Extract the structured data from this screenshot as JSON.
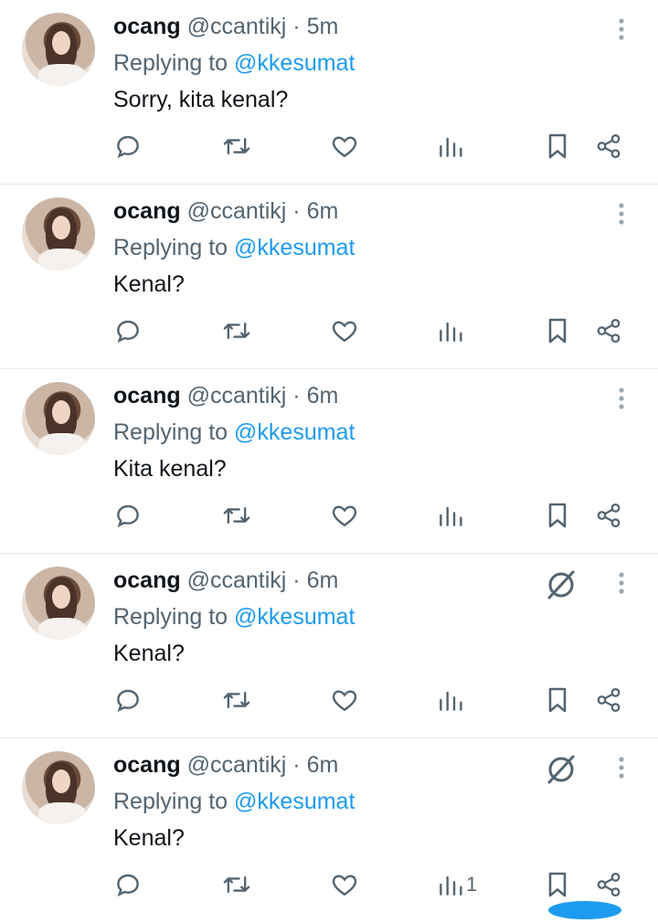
{
  "colors": {
    "text": "#0f1419",
    "secondary": "#536471",
    "accent": "#1d9bf0",
    "divider": "#e7e9ea"
  },
  "tweets": [
    {
      "name": "ocang",
      "handle": "@ccantikj",
      "separator": "·",
      "time": "5m",
      "replying_label": "Replying to",
      "mention": "@kkesumat",
      "text": "Sorry, kita kenal?",
      "views_count": "",
      "grok": false
    },
    {
      "name": "ocang",
      "handle": "@ccantikj",
      "separator": "·",
      "time": "6m",
      "replying_label": "Replying to",
      "mention": "@kkesumat",
      "text": "Kenal?",
      "views_count": "",
      "grok": false
    },
    {
      "name": "ocang",
      "handle": "@ccantikj",
      "separator": "·",
      "time": "6m",
      "replying_label": "Replying to",
      "mention": "@kkesumat",
      "text": "Kita kenal?",
      "views_count": "",
      "grok": false
    },
    {
      "name": "ocang",
      "handle": "@ccantikj",
      "separator": "·",
      "time": "6m",
      "replying_label": "Replying to",
      "mention": "@kkesumat",
      "text": "Kenal?",
      "views_count": "",
      "grok": true
    },
    {
      "name": "ocang",
      "handle": "@ccantikj",
      "separator": "·",
      "time": "6m",
      "replying_label": "Replying to",
      "mention": "@kkesumat",
      "text": "Kenal?",
      "views_count": "1",
      "grok": true
    }
  ],
  "icons": {
    "reply": "reply-icon",
    "retweet": "retweet-icon",
    "like": "heart-icon",
    "views": "views-icon",
    "bookmark": "bookmark-icon",
    "share": "share-icon",
    "more": "more-vertical-icon",
    "grok": "grok-icon"
  }
}
